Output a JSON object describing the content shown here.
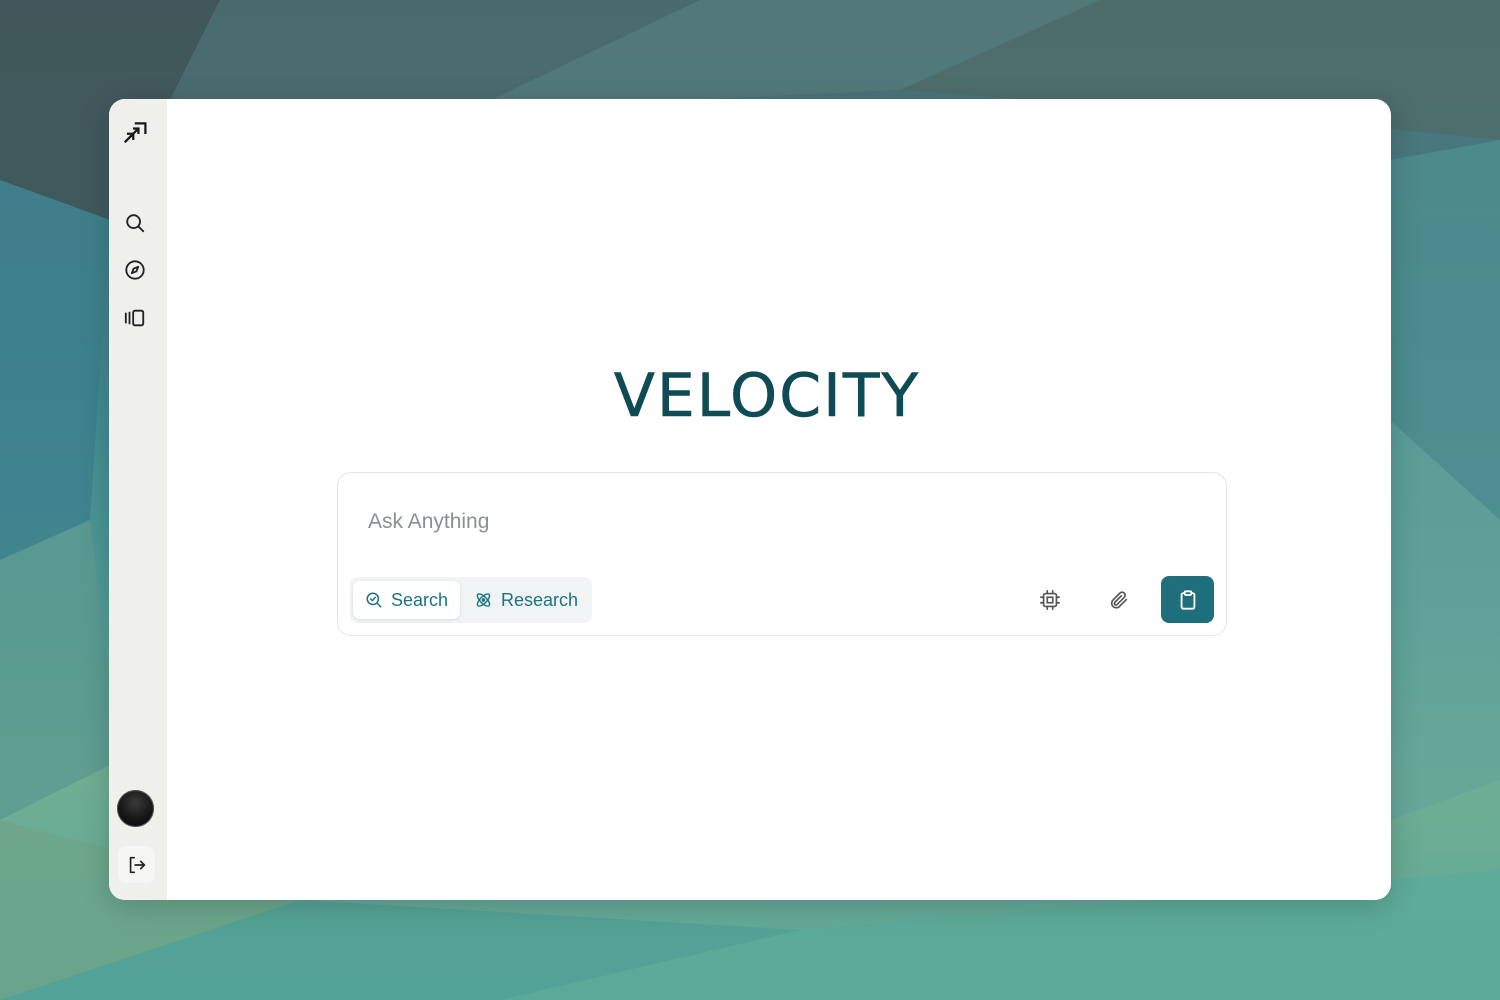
{
  "app": {
    "brand": "VELOCITY"
  },
  "sidebar": {
    "logo_icon": "trend-arrows-icon",
    "items": [
      {
        "icon": "search-icon"
      },
      {
        "icon": "compass-icon"
      },
      {
        "icon": "library-icon"
      }
    ],
    "footer": {
      "avatar": "user-avatar",
      "logout_icon": "logout-icon"
    }
  },
  "composer": {
    "placeholder": "Ask Anything",
    "value": "",
    "modes": [
      {
        "label": "Search",
        "icon": "search-check-icon",
        "active": true
      },
      {
        "label": "Research",
        "icon": "atom-icon",
        "active": false
      }
    ],
    "tools": [
      {
        "icon": "cpu-chip-icon"
      },
      {
        "icon": "paperclip-icon"
      }
    ],
    "submit_icon": "clipboard-icon"
  },
  "colors": {
    "accent": "#1f6e7c",
    "brand_text": "#0f4b55",
    "mode_text": "#1b7380",
    "sidebar_bg": "#efefec"
  }
}
